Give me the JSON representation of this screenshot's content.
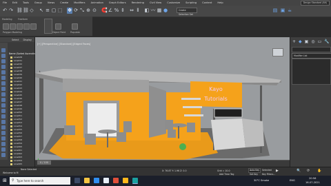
{
  "colors": {
    "accent": "#5a7fb0",
    "orange": "#f5a21b",
    "taskbar": "#1b1f2a",
    "viewport_bg": "#999c9f"
  },
  "menu": [
    "File",
    "Edit",
    "Tools",
    "Group",
    "Views",
    "Create",
    "Modifiers",
    "Animation",
    "Graph Editors",
    "Rendering",
    "Civil View",
    "Customize",
    "Scripting",
    "Content",
    "Help"
  ],
  "workspace": "Design Standard (Alt)",
  "toolbar_icons": [
    "undo-icon",
    "redo-icon",
    "link-icon",
    "unlink-icon",
    "bind-icon",
    "select-icon",
    "select-by-name-icon",
    "select-region-icon",
    "window-crossing-icon",
    "move-icon",
    "rotate-icon",
    "scale-icon",
    "select-place-icon",
    "pivot-icon",
    "snaps-icon",
    "angle-snap-icon",
    "percent-snap-icon",
    "spinner-snap-icon",
    "mirror-icon",
    "align-icon",
    "layer-icon",
    "curve-editor-icon",
    "schematic-icon",
    "material-editor-icon",
    "render-setup-icon",
    "render-frame-icon",
    "render-icon"
  ],
  "selection_set": "Create Selection Set",
  "ribbon": {
    "tab_modeling": "Modeling",
    "tab_freeform": "Freeform",
    "group_polygon": "Polygon Modeling",
    "label_object": "Object Paint",
    "label_populate": "Populate",
    "label_selection": "Selection"
  },
  "explorer": {
    "tabs": [
      "Select",
      "Display"
    ],
    "header": "Name (Sorted Ascending)",
    "rows": [
      "Line028",
      "Line031",
      "Line032",
      "Line037",
      "Line038",
      "Line039",
      "Line040",
      "Line041",
      "Line042",
      "Line043",
      "Line044",
      "Line045",
      "Line046",
      "Line047",
      "Line048",
      "Line049",
      "Line050",
      "Line051",
      "Line052",
      "Line053",
      "Line054",
      "Line055",
      "Line056",
      "Line057",
      "Line058",
      "Line059",
      "Line060",
      "Line061",
      "Line062",
      "Line063",
      "Line064",
      "Line065"
    ]
  },
  "viewport": {
    "label": "[+] [Perspective] [Standard] [Edged Faces]",
    "sign_line1": "Kayo",
    "sign_line2": "Tutorials"
  },
  "command_panel": {
    "modifier_list": "Modifier List"
  },
  "timeline": {
    "frame": "0 / 100"
  },
  "status": {
    "selection": "None Selected",
    "coords": "X: 76.87   Y: 1.96   Z: 0.0",
    "grid": "Grid = 10.0",
    "key_mode": "Auto Key",
    "selected": "Selected",
    "set_key": "Set Key",
    "key_filters": "Key Filters...",
    "add_time_tag": "Add Time Tag",
    "welcome": "Welcome to M"
  },
  "taskbar": {
    "search": "Type here to search",
    "weather": "30°C  Smoke",
    "lang": "ENG",
    "time": "20:56",
    "date": "16-07-2021"
  }
}
